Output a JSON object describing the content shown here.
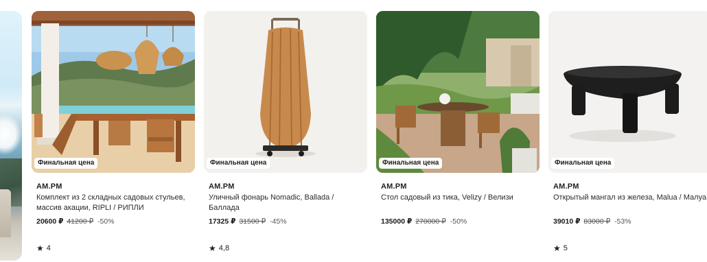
{
  "products": [
    {
      "badge": "Финальная цена",
      "brand": "AM.PM",
      "title": "Комплект из 2 складных садовых стульев, массив акации, RIPLI / РИПЛИ",
      "price": "20600 ₽",
      "old_price": "41200 ₽",
      "discount": "-50%",
      "rating": "4",
      "icon": "star-icon"
    },
    {
      "badge": "Финальная цена",
      "brand": "AM.PM",
      "title": "Уличный фонарь Nomadic, Ballada / Баллада",
      "price": "17325 ₽",
      "old_price": "31500 ₽",
      "discount": "-45%",
      "rating": "4,8",
      "icon": "star-icon"
    },
    {
      "badge": "Финальная цена",
      "brand": "AM.PM",
      "title": "Стол садовый из тика, Velizy / Велизи",
      "price": "135000 ₽",
      "old_price": "270000 ₽",
      "discount": "-50%",
      "rating": "",
      "icon": ""
    },
    {
      "badge": "Финальная цена",
      "brand": "AM.PM",
      "title": "Открытый мангал из железа, Malua / Малуа",
      "price": "39010 ₽",
      "old_price": "83000 ₽",
      "discount": "-53%",
      "rating": "5",
      "icon": "star-icon"
    }
  ]
}
